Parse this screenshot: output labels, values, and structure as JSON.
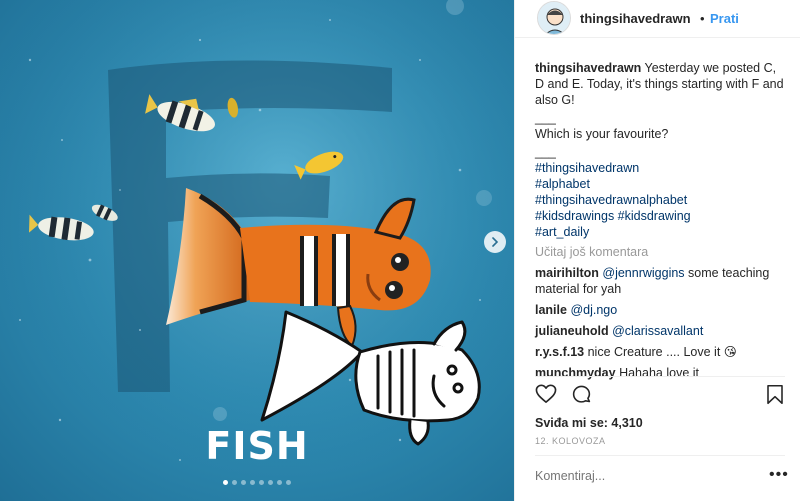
{
  "post": {
    "label": "FISH",
    "carousel_dots": 8,
    "carousel_active": 0
  },
  "header": {
    "username": "thingsihavedrawn",
    "separator": "•",
    "follow_label": "Prati"
  },
  "caption": {
    "user": "thingsihavedrawn",
    "text1": "Yesterday we posted C, D and E. Today, it's things starting with F and also G!",
    "rule1": "___",
    "text2": "Which is your favourite?",
    "rule2": "___",
    "hashtags": [
      "#thingsihavedrawn",
      "#alphabet",
      "#thingsihavedrawnalphabet",
      "#kidsdrawings #kidsdrawing",
      "#art_daily"
    ]
  },
  "load_more": "Učitaj još komentara",
  "comments": [
    {
      "user": "mairihilton",
      "mention": "@jennrwiggins",
      "text": " some teaching material for yah"
    },
    {
      "user": "lanile",
      "mention": "@dj.ngo",
      "text": ""
    },
    {
      "user": "julianeuhold",
      "mention": "@clarissavallant",
      "text": ""
    },
    {
      "user": "r.y.s.f.13",
      "mention": "",
      "text": "nice Creature .... Love it 😘"
    },
    {
      "user": "munchmyday",
      "mention": "",
      "text": "Hahaha love it"
    }
  ],
  "likes": "Sviđa mi se: 4,310",
  "date": "12. KOLOVOZA",
  "add_comment_placeholder": "Komentiraj...",
  "more_label": "•••",
  "icons": {
    "like": "heart-icon",
    "comment": "comment-icon",
    "save": "bookmark-icon",
    "next": "chevron-right-icon"
  },
  "colors": {
    "link": "#003569",
    "follow": "#3897f0",
    "muted": "#999999",
    "water": "#2f8db4",
    "clownfish": "#e8731c"
  }
}
